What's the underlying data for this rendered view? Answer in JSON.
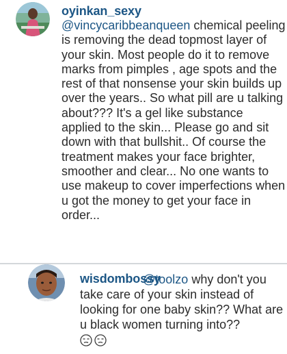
{
  "comments": [
    {
      "username": "oyinkan_sexy",
      "mention": "@vincycaribbeanqueen",
      "text": " chemical peeling is removing the dead topmost layer of your skin. Most people do it to remove marks from pimples , age spots and the rest of that nonsense your skin builds up over the years.. So what pill are u talking about??? It's a gel like substance applied to the skin... Please go and sit down with that bullshit.. Of course the treatment makes your face brighter, smoother and clear... No one wants to use makeup to cover imperfections when u got the money to get your face in order...",
      "avatar_icon": "user-avatar-photo"
    },
    {
      "username": "wisdombossy",
      "mention": "@toolzo",
      "text": " why don't you take care of your skin instead of looking for one baby skin?? What are u black women turning into??",
      "emojis": [
        "unamused-face-icon",
        "unamused-face-icon"
      ],
      "avatar_icon": "user-avatar-photo"
    }
  ],
  "colors": {
    "username": "#1c5685",
    "text": "#2b2b2b",
    "divider": "#d4d7da"
  }
}
